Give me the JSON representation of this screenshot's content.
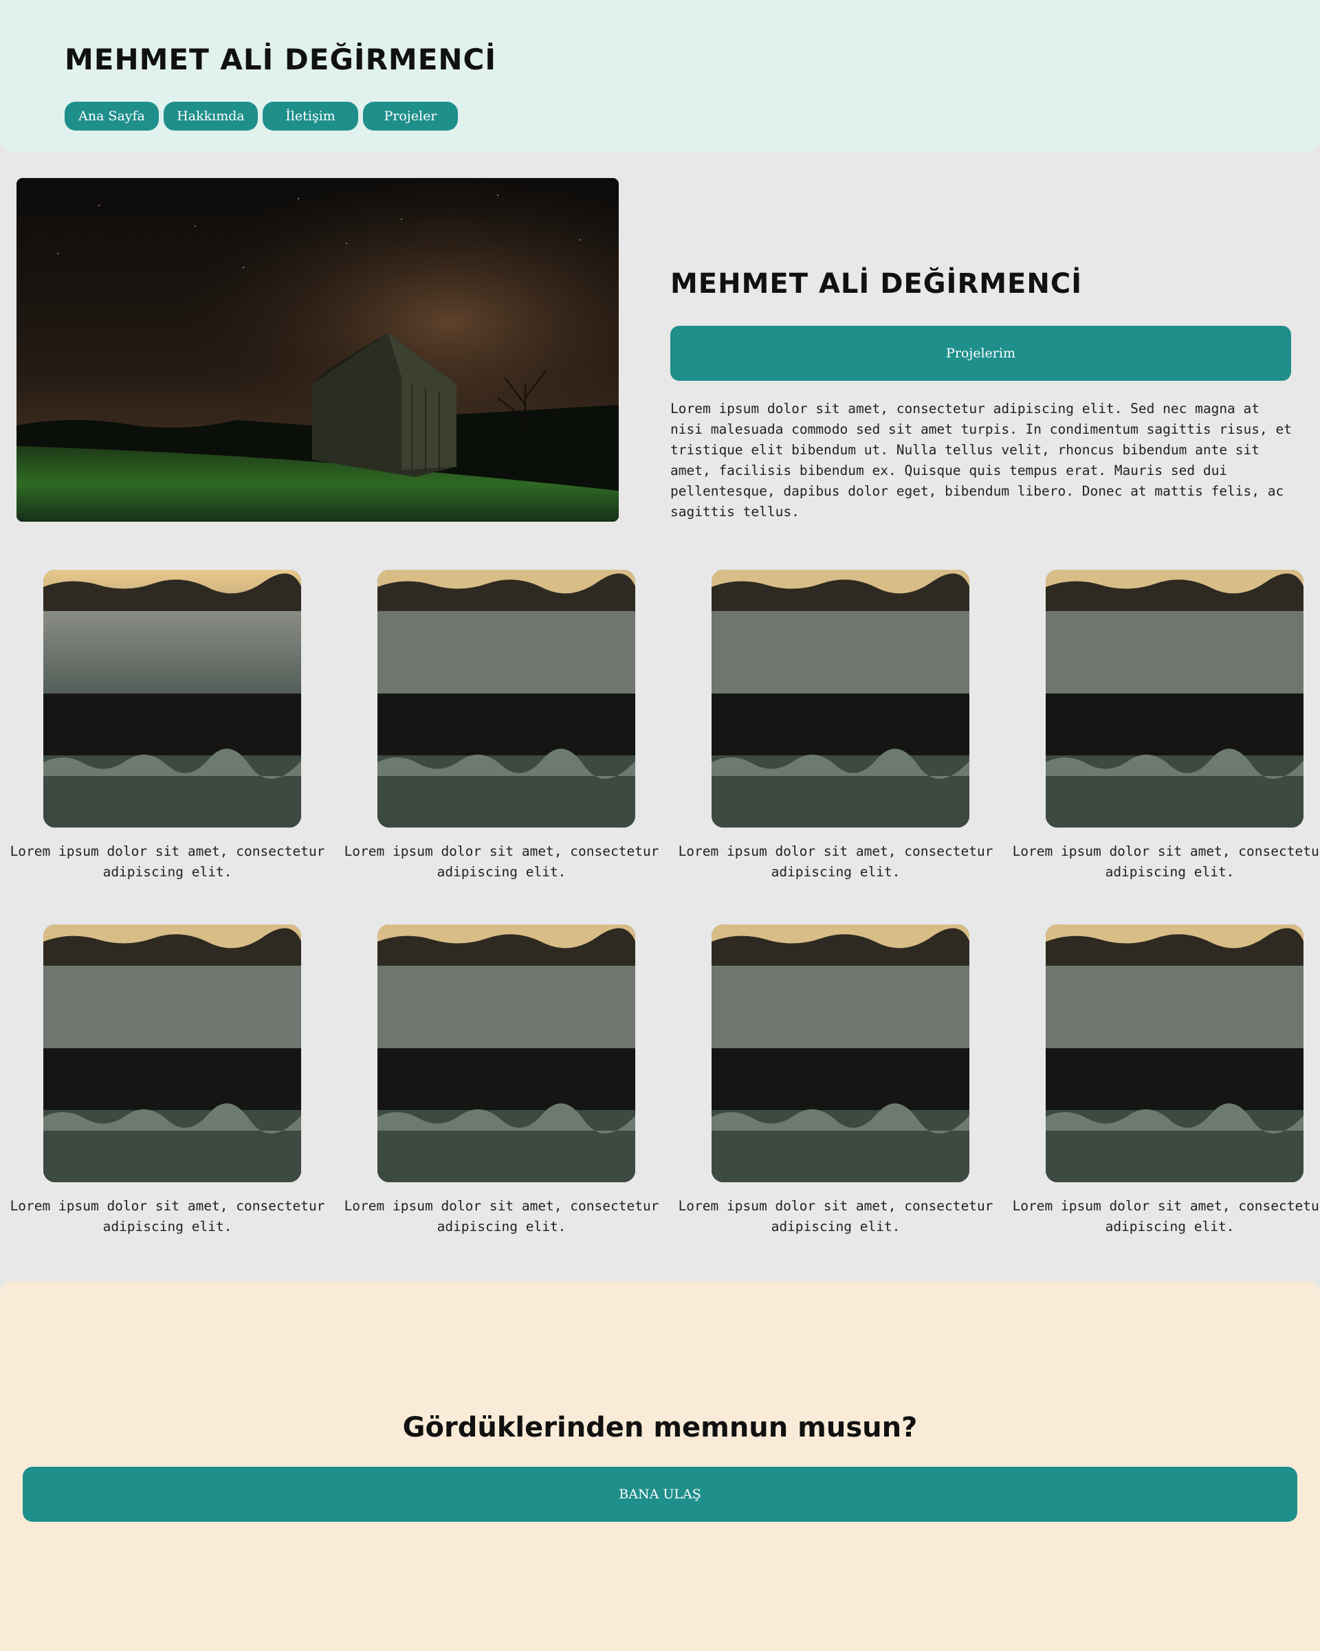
{
  "header": {
    "title": "MEHMET ALİ DEĞİRMENCİ",
    "nav": [
      {
        "label": "Ana Sayfa"
      },
      {
        "label": "Hakkımda"
      },
      {
        "label": "İletişim"
      },
      {
        "label": "Projeler"
      }
    ]
  },
  "hero": {
    "title": "MEHMET ALİ DEĞİRMENCİ",
    "button_label": "Projelerim",
    "text": "Lorem ipsum dolor sit amet, consectetur adipiscing elit. Sed nec magna at nisi malesuada commodo sed sit amet turpis. In condimentum sagittis risus, et tristique elit bibendum ut. Nulla tellus velit, rhoncus bibendum ante sit amet, facilisis bibendum ex. Quisque quis tempus erat. Mauris sed dui pellentesque, dapibus dolor eget, bibendum libero. Donec at mattis felis, ac sagittis tellus."
  },
  "gallery": {
    "items": [
      {
        "caption": "Lorem ipsum dolor sit amet, consectetur adipiscing elit."
      },
      {
        "caption": "Lorem ipsum dolor sit amet, consectetur adipiscing elit."
      },
      {
        "caption": "Lorem ipsum dolor sit amet, consectetur adipiscing elit."
      },
      {
        "caption": "Lorem ipsum dolor sit amet, consectetur adipiscing elit."
      },
      {
        "caption": "Lorem ipsum dolor sit amet, consectetur adipiscing elit."
      },
      {
        "caption": "Lorem ipsum dolor sit amet, consectetur adipiscing elit."
      },
      {
        "caption": "Lorem ipsum dolor sit amet, consectetur adipiscing elit."
      },
      {
        "caption": "Lorem ipsum dolor sit amet, consectetur adipiscing elit."
      }
    ]
  },
  "cta": {
    "title": "Gördüklerinden memnun musun?",
    "button_label": "BANA ULAŞ"
  },
  "colors": {
    "accent": "#1f8f8b",
    "header_bg": "#e1f1ed",
    "page_bg": "#e8e8e8",
    "cta_bg": "#f9ebd8"
  }
}
